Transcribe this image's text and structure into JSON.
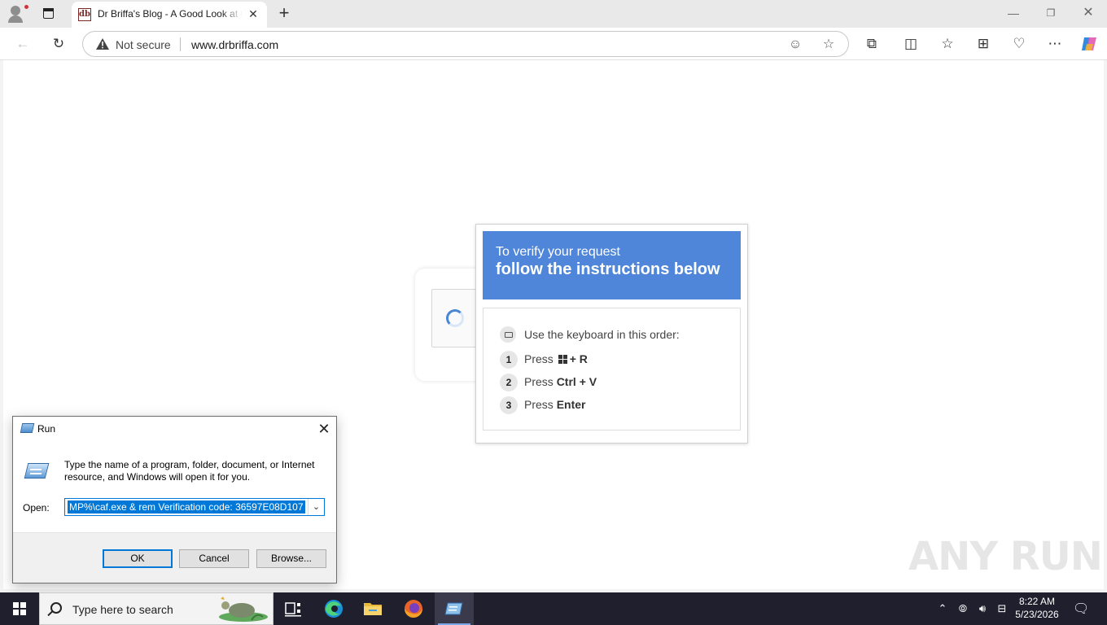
{
  "browser": {
    "tab": {
      "favicon_text": "db",
      "title": "Dr Briffa's Blog - A Good Look at the Good Life"
    },
    "address": {
      "security_label": "Not secure",
      "url": "www.drbriffa.com"
    }
  },
  "verify_popup": {
    "header_line1": "To verify your request",
    "header_line2": "follow the instructions below",
    "keyboard_hint": "Use the keyboard in this order:",
    "steps": [
      {
        "number": "1",
        "prefix": "Press",
        "keys": "+ R"
      },
      {
        "number": "2",
        "prefix": "Press",
        "keys": "Ctrl + V"
      },
      {
        "number": "3",
        "prefix": "Press",
        "keys": "Enter"
      }
    ],
    "header_color": "#4f86d9"
  },
  "watermark": {
    "text": "ANY RUN"
  },
  "run_dialog": {
    "title": "Run",
    "description": "Type the name of a program, folder, document, or Internet resource, and Windows will open it for you.",
    "open_label": "Open:",
    "open_value": "MP%\\caf.exe & rem  Verification code: 36597E08D107",
    "buttons": {
      "ok": "OK",
      "cancel": "Cancel",
      "browse": "Browse..."
    },
    "close_glyph": "✕"
  },
  "taskbar": {
    "search_placeholder": "Type here to search",
    "clock": {
      "time": "8:22 AM",
      "date": "5/23/2026"
    }
  }
}
